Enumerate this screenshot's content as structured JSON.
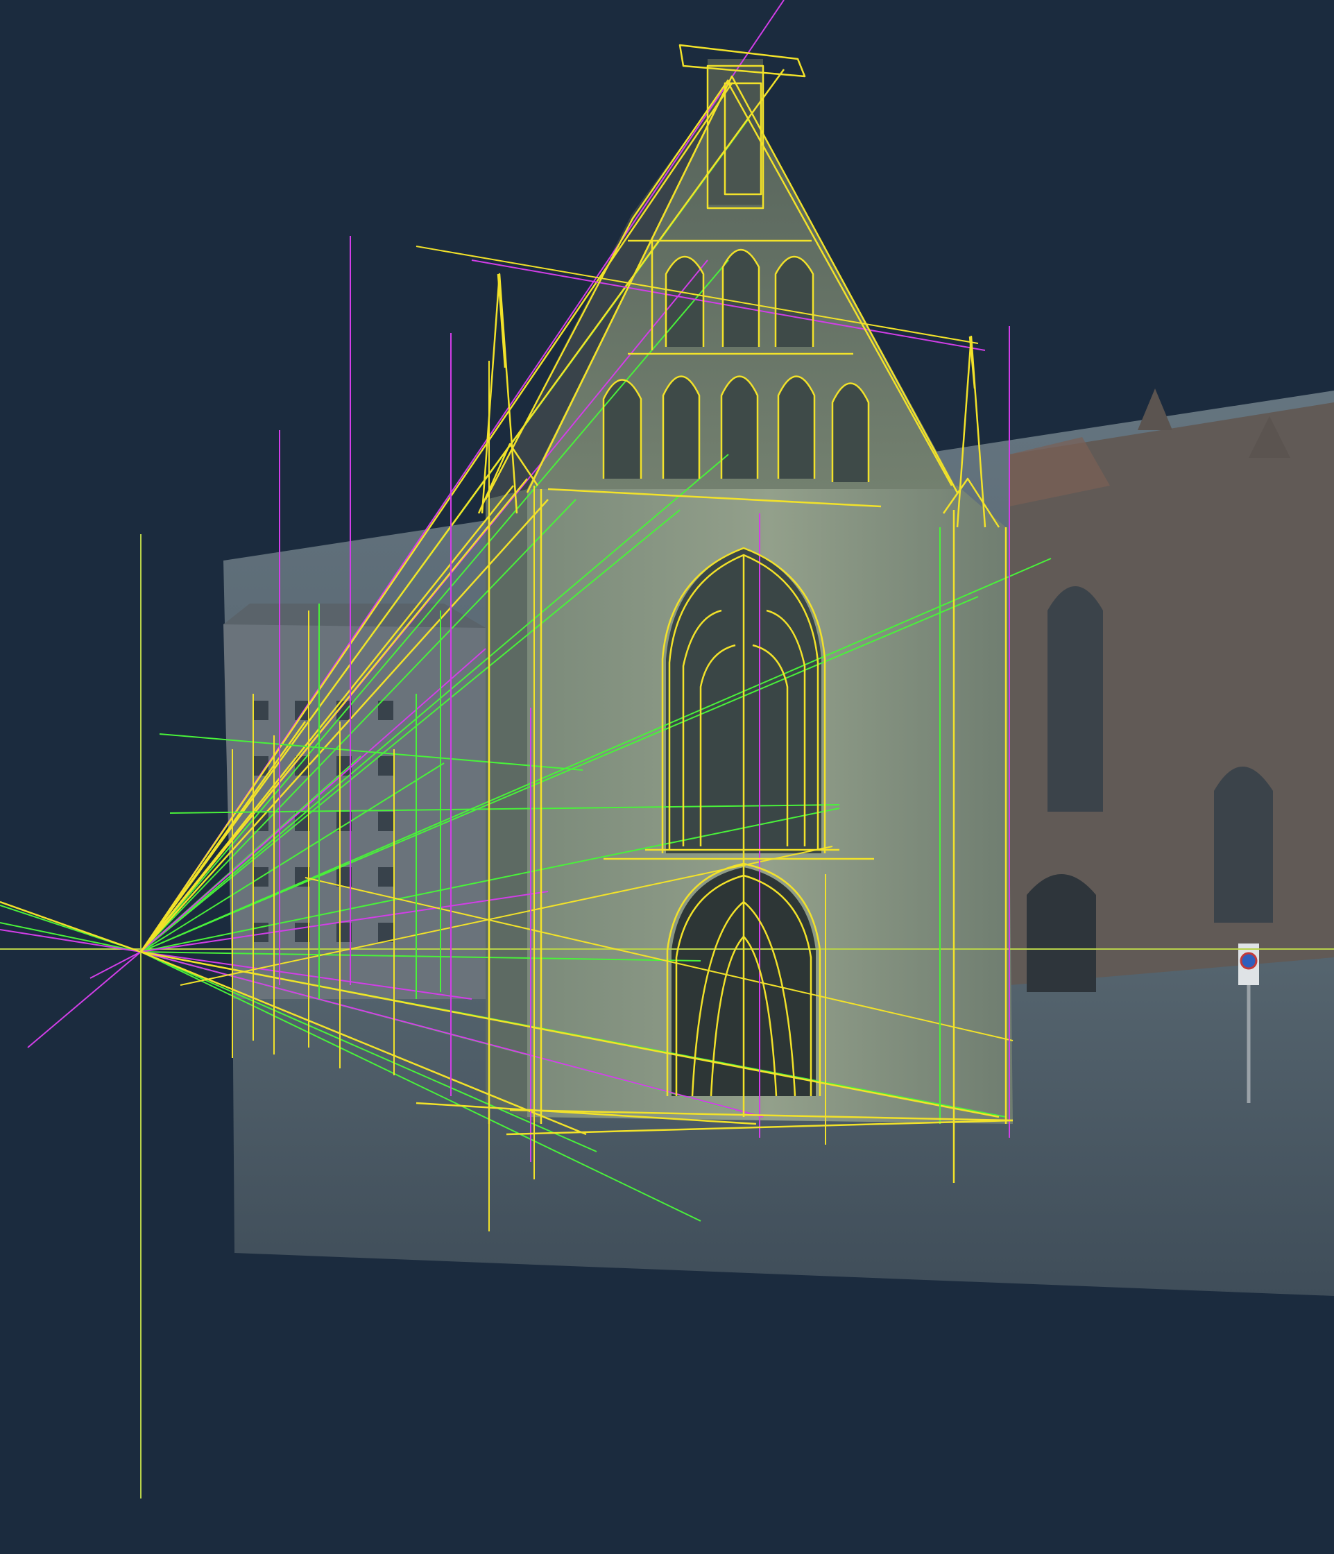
{
  "colors": {
    "background": "#1b2b3e",
    "construction_yellow": "#f2e22a",
    "construction_green": "#49f23a",
    "construction_magenta": "#d23ee8",
    "horizon_line": "#b8d24a",
    "photo_tint": "#6f7f86",
    "chapel_wall": "#8c9a86",
    "street_paving": "#4a5a66"
  },
  "layers": [
    {
      "name": "background-photo"
    },
    {
      "name": "chapel-facade"
    },
    {
      "name": "vanishing-lines"
    },
    {
      "name": "vertical-guides"
    },
    {
      "name": "gothic-outline-sketch"
    }
  ],
  "icons": {
    "vanishing_point": "crosshair-icon",
    "street_sign": "no-parking-sign-icon"
  }
}
